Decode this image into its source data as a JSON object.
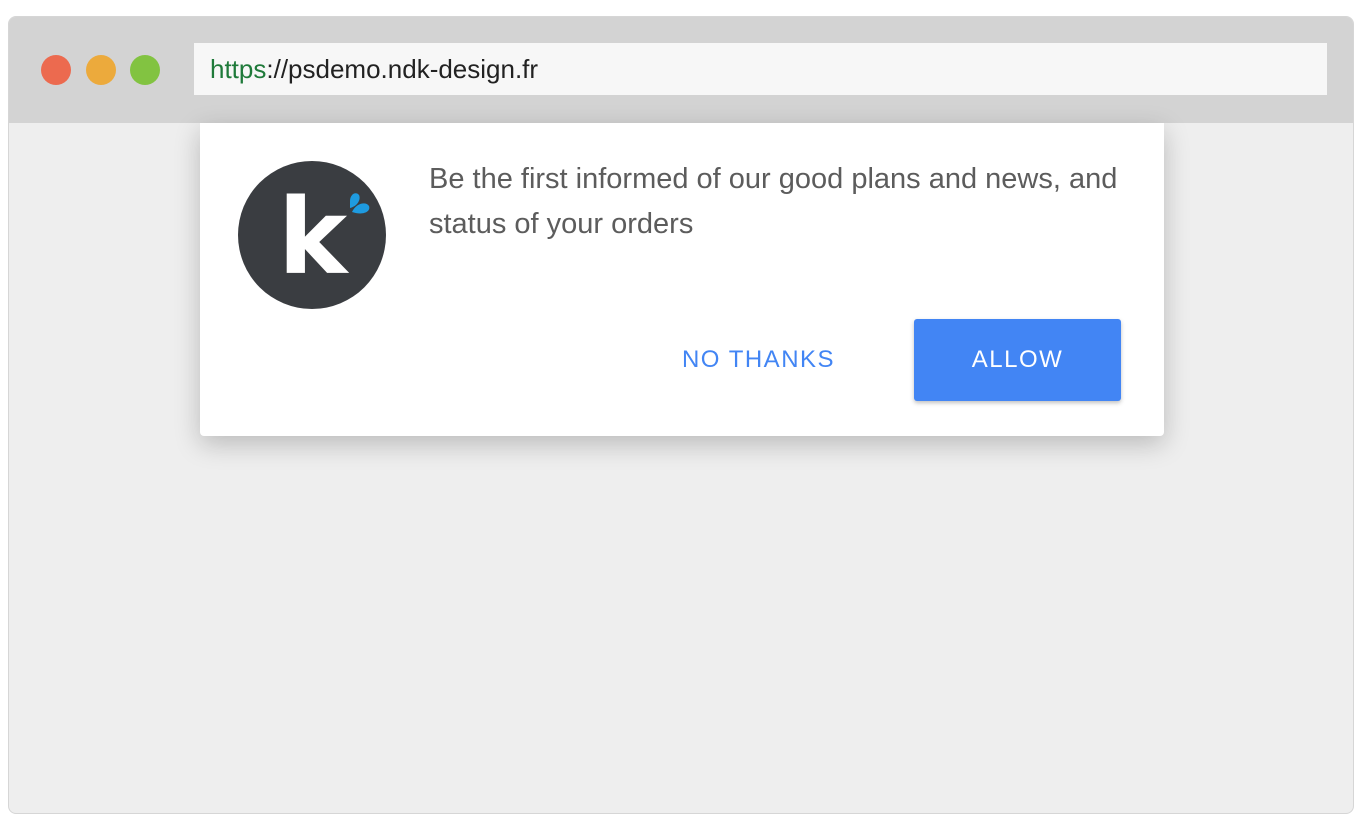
{
  "browser": {
    "url_scheme": "https",
    "url_rest": "://psdemo.ndk-design.fr",
    "traffic_lights": {
      "close_color": "#ec6a4f",
      "minimize_color": "#ecaa3c",
      "zoom_color": "#82c341"
    },
    "scheme_color": "#1f7a3a"
  },
  "popup": {
    "logo": {
      "icon": "ndk-k-logo-icon",
      "letter": "k",
      "bg_color": "#3a3d41",
      "accent_color": "#1e9be0"
    },
    "message": "Be the first informed of our good plans and news, and status of your orders",
    "no_thanks_label": "NO THANKS",
    "allow_label": "ALLOW",
    "accent_color": "#4285f4"
  }
}
